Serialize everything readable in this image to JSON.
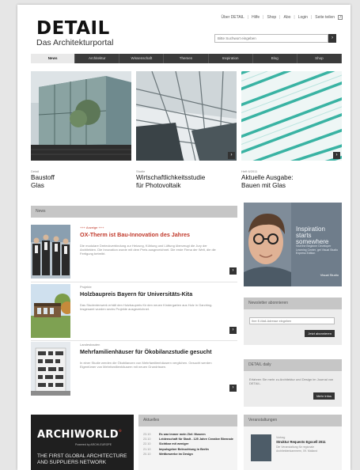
{
  "header": {
    "logo": "DETAIL",
    "subtitle": "Das Architekturportal",
    "links": [
      "Über DETAIL",
      "Hilfe",
      "Shop",
      "Abo",
      "Login"
    ],
    "newsletter": "Seite teilen",
    "search_placeholder": "Bitte Suchwort eingeben"
  },
  "nav": {
    "tabs": [
      "News",
      "Architektur",
      "Wissenschaft",
      "Themen",
      "Inspiration",
      "Blog",
      "Shop"
    ]
  },
  "features": [
    {
      "kicker": "Detail",
      "title_line1": "Baustoff",
      "title_line2": "Glas"
    },
    {
      "kicker": "Studie",
      "title_line1": "Wirtschaftlichkeitsstudie",
      "title_line2": "für Photovoltaik"
    },
    {
      "kicker": "Heft 6/2011",
      "title_line1": "Aktuelle Ausgabe:",
      "title_line2": "Bauen mit Glas"
    }
  ],
  "news": {
    "heading": "News",
    "items": [
      {
        "kicker": "+++ Anzeige +++",
        "title": "OX-Therm ist Bau-Innovation des Jahres",
        "text": "Die modulare Dreieckverbindung zur Heizung, Kühlung und Lüftung überzeugt die Jury der Architekten. Die Innovation wurde mit dem Preis ausgezeichnet. Die erste Firma der Welt, die die Fertigung betreibt."
      },
      {
        "kicker": "Projekte",
        "title": "Holzbaupreis Bayern für Universitäts-Kita",
        "text": "Das Studentenwerk erhält den Holzbaupreis für den neuen Kindergarten aus Holz in Garching. Insgesamt wurden sechs Projekte ausgezeichnet."
      },
      {
        "kicker": "Landesbauten",
        "title": "Mehrfamilienhäuser für Ökobilanzstudie gesucht",
        "text": "In einer Studie werden die Ökobilanzen von Mehrfamilienhäusern verglichen. Gesucht werden Eigentümer von Mehrfamilienhäusern mit neuen Grundrissen."
      }
    ]
  },
  "ad": {
    "headline": "Inspiration starts somewhere",
    "body": "Visit the Beginner Developer Learning Center, get Visual Studio Express Edition",
    "brand": "Visual Studio"
  },
  "newsletter_box": {
    "heading": "Newsletter abonnieren",
    "placeholder": "Ihre E-Mail-Adresse eingeben",
    "button": "Jetzt abonnieren"
  },
  "daily_box": {
    "heading": "DETAIL daily",
    "text": "Erfahren Sie mehr zu Architektur und Design im Journal von DETAIL.",
    "button": "Mehr Infos"
  },
  "archiworld": {
    "logo": "ARCHIWORLD",
    "reg": "®",
    "powered": "Powered by ARCHI-EUROPE",
    "slogan": "THE FIRST GLOBAL ARCHITECTURE AND SUPPLIERS NETWORK"
  },
  "aktuelles": {
    "heading": "Aktuelles",
    "rows": [
      {
        "date": "23.10",
        "text": "Es war immer mein Ziel: Museen"
      },
      {
        "date": "23.10",
        "text": "Leidenschaft für Stadt - 125 Jahre Creative Biennale"
      },
      {
        "date": "22.10",
        "text": "Sichtbar mit weniger"
      },
      {
        "date": "21.10",
        "text": "Impulsgeber Beleuchtung in Berlin"
      },
      {
        "date": "20.10",
        "text": "Wettbewerbe im Design"
      }
    ]
  },
  "veranstaltungen": {
    "heading": "Veranstaltungen",
    "kicker": "Vortrag",
    "title": "Struktur Requests Egocell 2011",
    "sub": "Die Veranstaltung für regionale Architektenkammern, 09. Mailand"
  }
}
